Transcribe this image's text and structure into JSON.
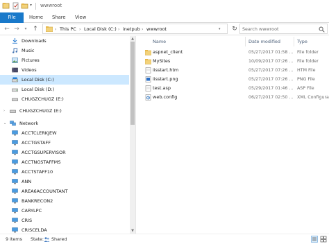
{
  "window": {
    "title": "wwwroot"
  },
  "ribbon": {
    "tabs": [
      "File",
      "Home",
      "Share",
      "View"
    ]
  },
  "address": {
    "crumbs": [
      "This PC",
      "Local Disk (C:)",
      "inetpub",
      "wwwroot"
    ],
    "search_placeholder": "Search wwwroot"
  },
  "navigation": {
    "items": [
      {
        "label": "Downloads",
        "icon": "download-arrow-icon",
        "selected": false
      },
      {
        "label": "Music",
        "icon": "music-note-icon",
        "selected": false
      },
      {
        "label": "Pictures",
        "icon": "pictures-icon",
        "selected": false
      },
      {
        "label": "Videos",
        "icon": "videos-icon",
        "selected": false
      },
      {
        "label": "Local Disk (C:)",
        "icon": "drive-icon",
        "selected": true
      },
      {
        "label": "Local Disk (D:)",
        "icon": "drive-icon",
        "selected": false
      },
      {
        "label": "CHUGZCHUGZ (E:)",
        "icon": "usb-drive-icon",
        "selected": false
      },
      {
        "label": "CHUGZCHUGZ (E:)",
        "icon": "usb-drive-icon",
        "selected": false
      },
      {
        "label": "Network",
        "icon": "network-icon",
        "selected": false
      },
      {
        "label": "ACCTCLERKJEW",
        "icon": "computer-icon",
        "selected": false
      },
      {
        "label": "ACCTGSTAFF",
        "icon": "computer-icon",
        "selected": false
      },
      {
        "label": "ACCTGSUPERVISOR",
        "icon": "computer-icon",
        "selected": false
      },
      {
        "label": "ACCTNGSTAFFMS",
        "icon": "computer-icon",
        "selected": false
      },
      {
        "label": "ACCTSTAFF10",
        "icon": "computer-icon",
        "selected": false
      },
      {
        "label": "ANN",
        "icon": "computer-icon",
        "selected": false
      },
      {
        "label": "AREA6ACCOUNTANT",
        "icon": "computer-icon",
        "selected": false
      },
      {
        "label": "BANKRECON2",
        "icon": "computer-icon",
        "selected": false
      },
      {
        "label": "CARYLPC",
        "icon": "computer-icon",
        "selected": false
      },
      {
        "label": "CRIS",
        "icon": "computer-icon",
        "selected": false
      },
      {
        "label": "CRISCELDA",
        "icon": "computer-icon",
        "selected": false
      }
    ]
  },
  "files": {
    "columns": [
      "Name",
      "Date modified",
      "Type"
    ],
    "rows": [
      {
        "name": "aspnet_client",
        "date": "05/27/2017 01:58 ...",
        "type": "File folder",
        "icon": "folder-icon"
      },
      {
        "name": "MySites",
        "date": "10/09/2017 07:26 ...",
        "type": "File folder",
        "icon": "folder-icon"
      },
      {
        "name": "iisstart.htm",
        "date": "05/27/2017 07:26 ...",
        "type": "HTM File",
        "icon": "html-file-icon"
      },
      {
        "name": "iisstart.png",
        "date": "05/27/2017 07:26 ...",
        "type": "PNG File",
        "icon": "image-file-icon"
      },
      {
        "name": "test.asp",
        "date": "05/29/2017 01:46 ...",
        "type": "ASP File",
        "icon": "asp-file-icon"
      },
      {
        "name": "web.config",
        "date": "06/27/2017 02:50 ...",
        "type": "XML Configurati",
        "icon": "config-file-icon"
      }
    ]
  },
  "status": {
    "count": "9 items",
    "state_label": "State:",
    "state_value": "Shared"
  },
  "colors": {
    "accent": "#1979ca",
    "selection": "#cce8ff",
    "folder": "#e8b84a"
  }
}
